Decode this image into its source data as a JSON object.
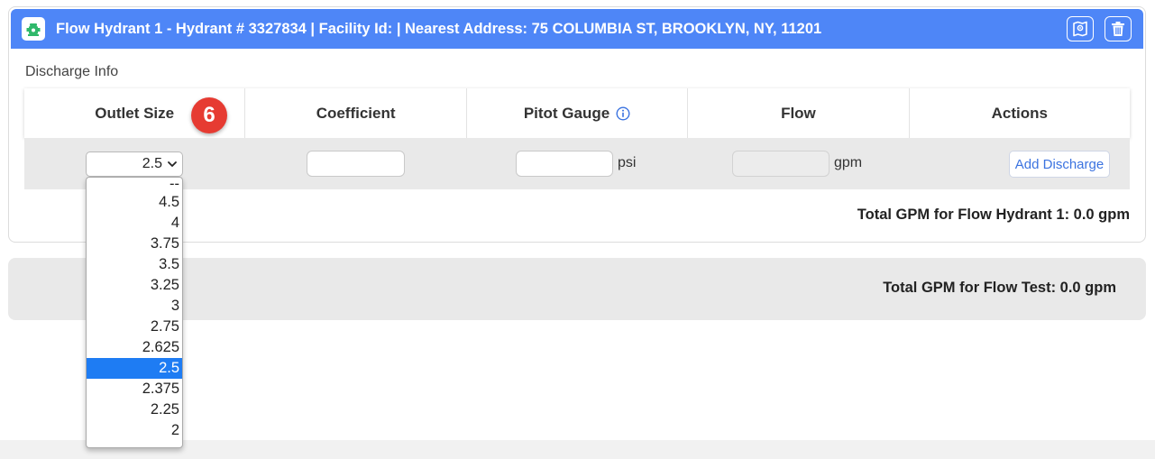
{
  "hydrant": {
    "title": "Flow Hydrant 1 - Hydrant # 3327834 | Facility Id: | Nearest Address: 75 COLUMBIA ST, BROOKLYN, NY, 11201",
    "icon": "hydrant-icon",
    "buttons": [
      "map-icon",
      "trash-icon"
    ]
  },
  "discharge": {
    "section_label": "Discharge Info",
    "columns": [
      "Outlet Size",
      "Coefficient",
      "Pitot Gauge",
      "Flow",
      "Actions"
    ],
    "step_badge": "6",
    "row": {
      "outlet_size": "2.5",
      "coefficient": "",
      "pitot_gauge": "",
      "pitot_unit": "psi",
      "flow": "",
      "flow_unit": "gpm",
      "action_label": "Add Discharge"
    },
    "outlet_options": [
      "--",
      "4.5",
      "4",
      "3.75",
      "3.5",
      "3.25",
      "3",
      "2.75",
      "2.625",
      "2.5",
      "2.375",
      "2.25",
      "2"
    ],
    "selected_option": "2.5"
  },
  "totals": {
    "hydrant_total": "Total GPM for Flow Hydrant 1: 0.0 gpm",
    "test_total": "Total GPM for Flow Test: 0.0 gpm"
  },
  "colors": {
    "header_bg": "#4e86f7",
    "badge": "#e63b32",
    "selected_option": "#1e7cf3",
    "hydrant_icon": "#2fb86a"
  }
}
